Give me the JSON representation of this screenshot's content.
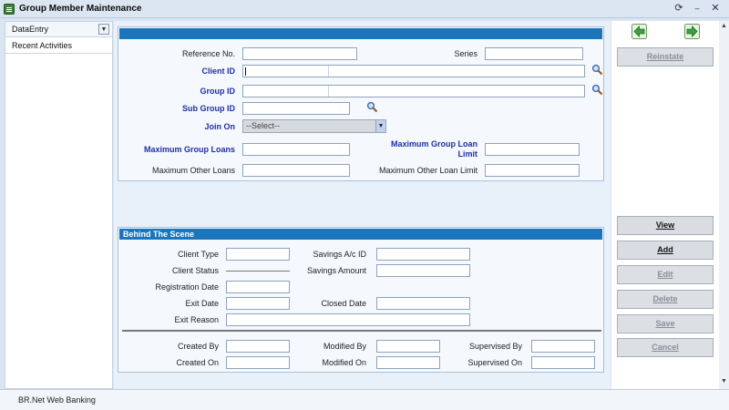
{
  "window": {
    "title": "Group Member Maintenance"
  },
  "sidebar": {
    "items": [
      {
        "label": "DataEntry"
      },
      {
        "label": "Recent Activities"
      }
    ]
  },
  "form": {
    "reference_no": {
      "label": "Reference No.",
      "value": ""
    },
    "series": {
      "label": "Series",
      "value": ""
    },
    "client_id": {
      "label": "Client ID",
      "value": ""
    },
    "group_id": {
      "label": "Group ID",
      "value": ""
    },
    "sub_group_id": {
      "label": "Sub Group ID",
      "value": ""
    },
    "join_on": {
      "label": "Join On",
      "selected": "--Select--"
    },
    "max_group_loans": {
      "label": "Maximum Group Loans",
      "value": ""
    },
    "max_group_loan_limit": {
      "label": "Maximum Group Loan Limit",
      "value": ""
    },
    "max_other_loans": {
      "label": "Maximum Other Loans",
      "value": ""
    },
    "max_other_loan_limit": {
      "label": "Maximum Other Loan Limit",
      "value": ""
    }
  },
  "behind": {
    "title": "Behind The Scene",
    "client_type": "Client Type",
    "savings_ac_id": "Savings A/c ID",
    "client_status": "Client Status",
    "savings_amount": "Savings Amount",
    "registration_date": "Registration Date",
    "exit_date": "Exit Date",
    "closed_date": "Closed Date",
    "exit_reason": "Exit Reason",
    "created_by": "Created By",
    "modified_by": "Modified By",
    "supervised_by": "Supervised By",
    "created_on": "Created On",
    "modified_on": "Modified On",
    "supervised_on": "Supervised On"
  },
  "actions": {
    "reinstate": "Reinstate",
    "view": "View",
    "add": "Add",
    "edit": "Edit",
    "delete": "Delete",
    "save": "Save",
    "cancel": "Cancel"
  },
  "status": {
    "text": "BR.Net Web Banking"
  },
  "colors": {
    "header_blue": "#1b75bb",
    "label_blue": "#1f2fa3",
    "nav_green": "#3aa33a"
  }
}
